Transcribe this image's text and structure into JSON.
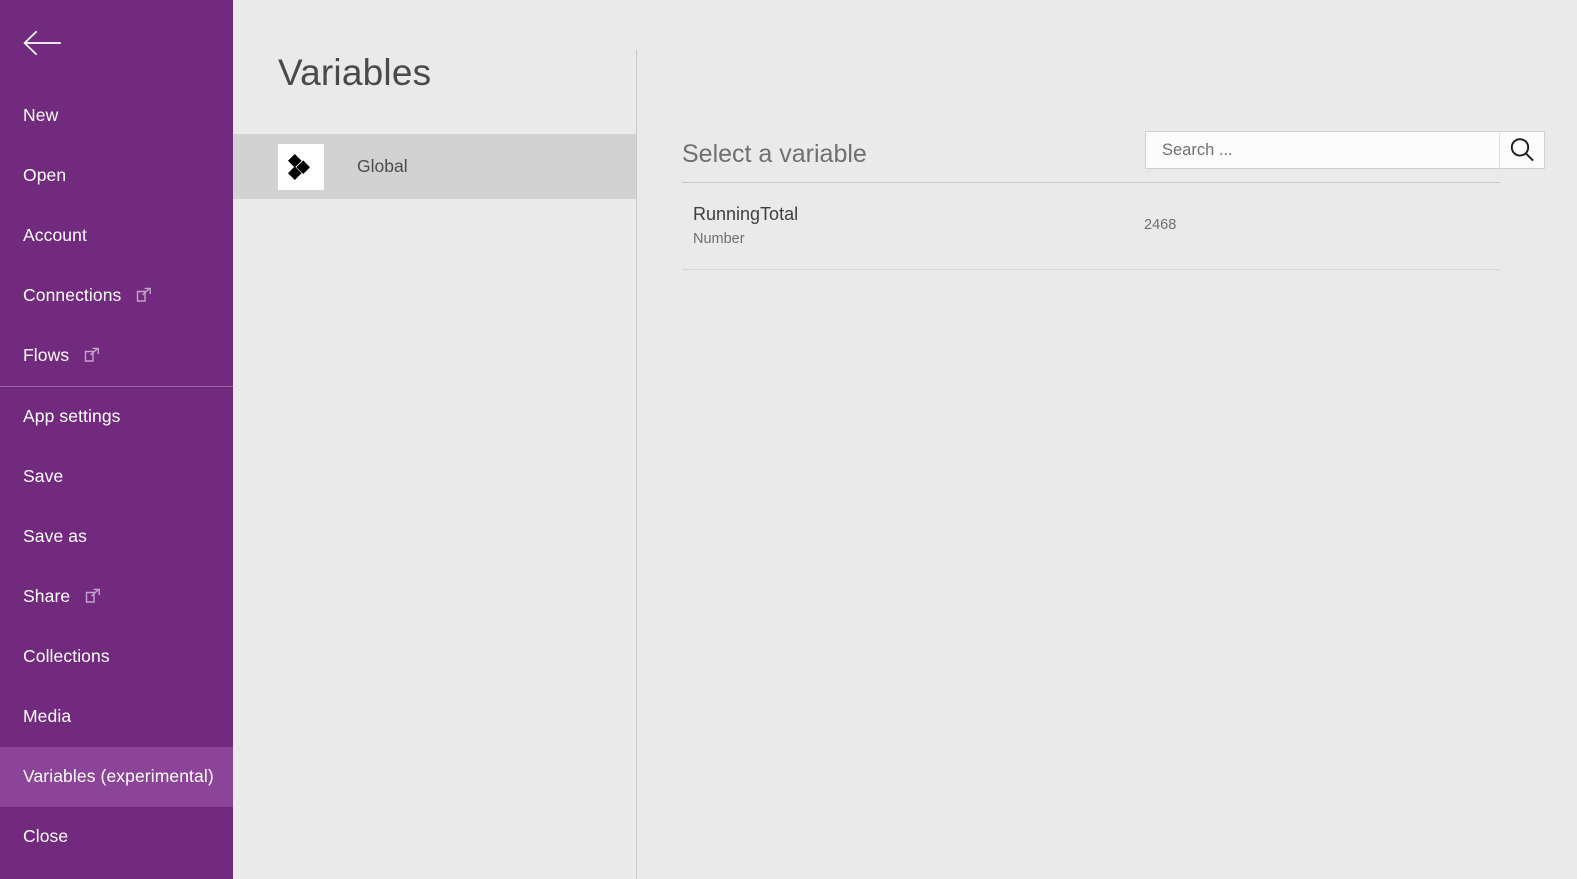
{
  "colors": {
    "sidebar_purple": "#722a7f",
    "sidebar_selected": "#8b4497",
    "panel_gray": "#eaeaea",
    "scope_row_gray": "#d2d2d2"
  },
  "sidebar": {
    "back_icon": "back-arrow-icon",
    "items": [
      {
        "label": "New",
        "icon": null,
        "selected": false,
        "divider_after": false
      },
      {
        "label": "Open",
        "icon": null,
        "selected": false,
        "divider_after": false
      },
      {
        "label": "Account",
        "icon": null,
        "selected": false,
        "divider_after": false
      },
      {
        "label": "Connections",
        "icon": "external-link-icon",
        "selected": false,
        "divider_after": false
      },
      {
        "label": "Flows",
        "icon": "external-link-icon",
        "selected": false,
        "divider_after": true
      },
      {
        "label": "App settings",
        "icon": null,
        "selected": false,
        "divider_after": false
      },
      {
        "label": "Save",
        "icon": null,
        "selected": false,
        "divider_after": false
      },
      {
        "label": "Save as",
        "icon": null,
        "selected": false,
        "divider_after": false
      },
      {
        "label": "Share",
        "icon": "external-link-icon",
        "selected": false,
        "divider_after": false
      },
      {
        "label": "Collections",
        "icon": null,
        "selected": false,
        "divider_after": false
      },
      {
        "label": "Media",
        "icon": null,
        "selected": false,
        "divider_after": false
      },
      {
        "label": "Variables (experimental)",
        "icon": null,
        "selected": true,
        "divider_after": false
      },
      {
        "label": "Close",
        "icon": null,
        "selected": false,
        "divider_after": false
      }
    ]
  },
  "panel": {
    "title": "Variables",
    "scopes": [
      {
        "label": "Global",
        "icon": "global-variables-icon",
        "selected": true
      }
    ]
  },
  "main": {
    "header_title": "Select a variable",
    "search": {
      "value": "",
      "placeholder": "Search ...",
      "icon": "search-icon"
    },
    "variables": [
      {
        "name": "RunningTotal",
        "type": "Number",
        "value": "2468"
      }
    ]
  }
}
